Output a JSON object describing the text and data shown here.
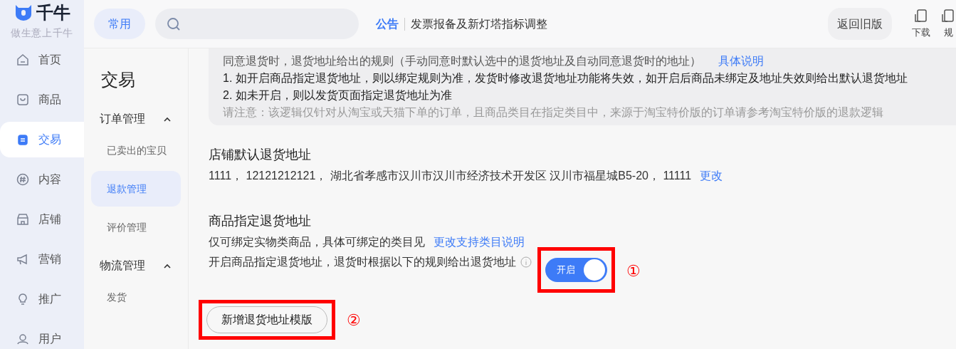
{
  "logo": {
    "name": "千牛",
    "slogan": "做生意上千牛"
  },
  "nav": [
    {
      "label": "首页",
      "kind": "home",
      "selected": false
    },
    {
      "label": "商品",
      "kind": "bag",
      "selected": false
    },
    {
      "label": "交易",
      "kind": "trade",
      "selected": true
    },
    {
      "label": "内容",
      "kind": "hash",
      "selected": false
    },
    {
      "label": "店铺",
      "kind": "store",
      "selected": false
    },
    {
      "label": "营销",
      "kind": "megaphone",
      "selected": false
    },
    {
      "label": "推广",
      "kind": "bulb",
      "selected": false
    },
    {
      "label": "用户",
      "kind": "user",
      "selected": false
    }
  ],
  "header": {
    "common_button": "常用",
    "notice_label": "公告",
    "notice_text": "发票报备及新灯塔指标调整",
    "old_version_button": "返回旧版",
    "tools": [
      {
        "label": "下载"
      },
      {
        "label": "规"
      }
    ]
  },
  "subnav": {
    "title": "交易",
    "groups": [
      {
        "label": "订单管理",
        "expanded": true,
        "items": [
          {
            "label": "已卖出的宝贝",
            "selected": false
          },
          {
            "label": "退款管理",
            "selected": true
          },
          {
            "label": "评价管理",
            "selected": false
          }
        ]
      },
      {
        "label": "物流管理",
        "expanded": true,
        "items": [
          {
            "label": "发货",
            "selected": false
          }
        ]
      }
    ]
  },
  "notice_box": {
    "heading": "同意退货时，退货地址给出的规则（手动同意时默认选中的退货地址及自动同意退货时的地址）",
    "heading_link": "具体说明",
    "lines": [
      "1. 如开启商品指定退货地址，则以绑定规则为准，发货时修改退货地址功能将失效，如开启后商品未绑定及地址失效则给出默认退货地址",
      "2. 如未开启，则以发货页面指定退货地址为准"
    ],
    "note": "请注意：该逻辑仅针对从淘宝或天猫下单的订单，且商品类目在指定类目中，来源于淘宝特价版的订单请参考淘宝特价版的退款逻辑"
  },
  "default_address": {
    "title": "店铺默认退货地址",
    "address": "1111， 12121212121， 湖北省孝感市汉川市汉川市经济技术开发区 汉川市福星城B5-20， 11111",
    "change_link": "更改"
  },
  "product_address": {
    "title": "商品指定退货地址",
    "desc": "仅可绑定实物类商品，具体可绑定的类目见",
    "desc_link": "更改支持类目说明",
    "toggle_label": "开启商品指定退货地址，退货时根据以下的规则给出退货地址",
    "toggle": {
      "on": true,
      "label": "开启",
      "annotation": "①"
    },
    "add_button": {
      "label": "新增退货地址模版",
      "annotation": "②"
    }
  }
}
